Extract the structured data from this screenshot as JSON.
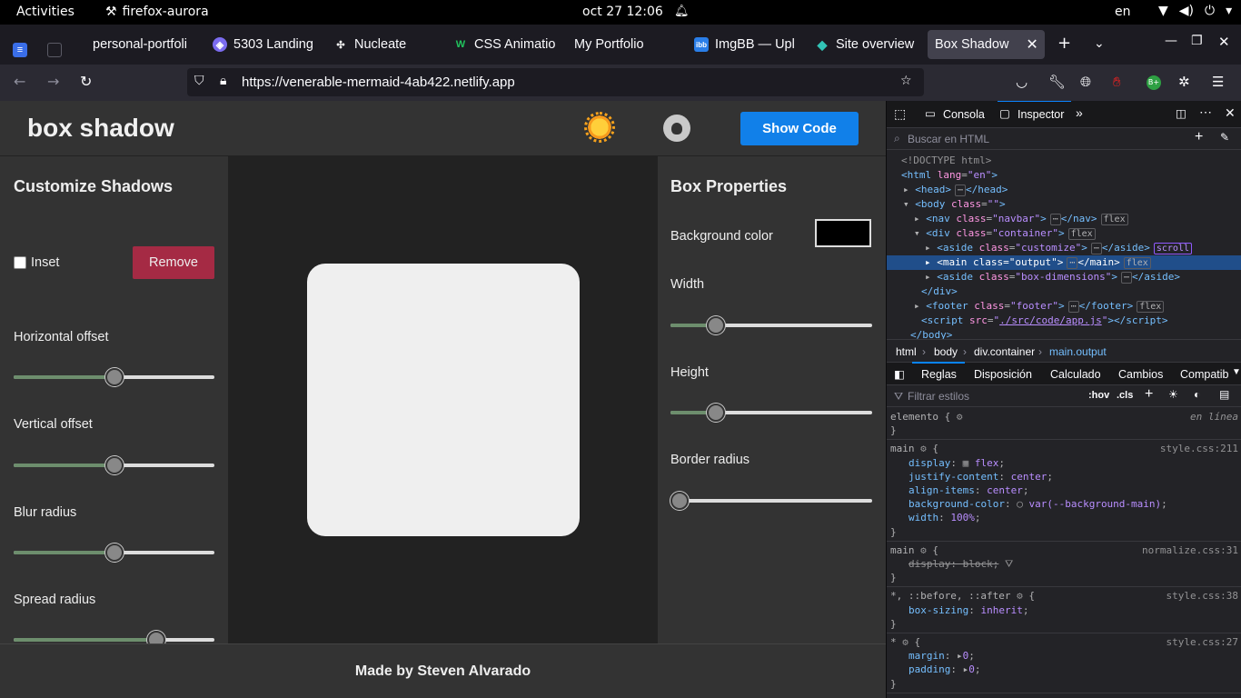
{
  "system": {
    "activities": "Activities",
    "app_name": "firefox-aurora",
    "clock": "oct 27  12:06",
    "lang": "en"
  },
  "browser": {
    "tabs": [
      {
        "label": "personal-portfoli",
        "icon": "tab-favicon-generic"
      },
      {
        "label": "5303 Landing",
        "icon": "tab-favicon-shield"
      },
      {
        "label": "Nucleate",
        "icon": "tab-favicon-nucleate"
      },
      {
        "label": "CSS Animatio",
        "icon": "tab-favicon-webflow"
      },
      {
        "label": "My Portfolio",
        "icon": "tab-favicon-none"
      },
      {
        "label": "ImgBB — Upl",
        "icon": "tab-favicon-imgbb"
      },
      {
        "label": "Site overview",
        "icon": "tab-favicon-netlify"
      },
      {
        "label": "Box Shadow",
        "icon": "tab-favicon-none",
        "active": true
      }
    ],
    "url": "https://venerable-mermaid-4ab422.netlify.app"
  },
  "page": {
    "brand": "box shadow",
    "show_code_label": "Show Code",
    "customize": {
      "title": "Customize Shadows",
      "inset_label": "Inset",
      "inset_checked": false,
      "remove_label": "Remove",
      "sliders": [
        {
          "label": "Horizontal offset",
          "value_pct": 50
        },
        {
          "label": "Vertical offset",
          "value_pct": 50
        },
        {
          "label": "Blur radius",
          "value_pct": 50
        },
        {
          "label": "Spread radius",
          "value_pct": 73
        }
      ]
    },
    "box_properties": {
      "title": "Box Properties",
      "bg_label": "Background color",
      "bg_color": "#000000",
      "sliders": [
        {
          "label": "Width",
          "value_pct": 20
        },
        {
          "label": "Height",
          "value_pct": 20
        },
        {
          "label": "Border radius",
          "value_pct": 0
        }
      ]
    },
    "footer": "Made by Steven Alvarado"
  },
  "devtools": {
    "tabs": {
      "console": "Consola",
      "inspector": "Inspector"
    },
    "search_placeholder": "Buscar en HTML",
    "breadcrumbs": [
      "html",
      "body",
      "div.container",
      "main.output"
    ],
    "rule_tabs": [
      "Reglas",
      "Disposición",
      "Calculado",
      "Cambios",
      "Compatib"
    ],
    "filter_placeholder": "Filtrar estilos",
    "hov": ":hov",
    "cls": ".cls"
  }
}
